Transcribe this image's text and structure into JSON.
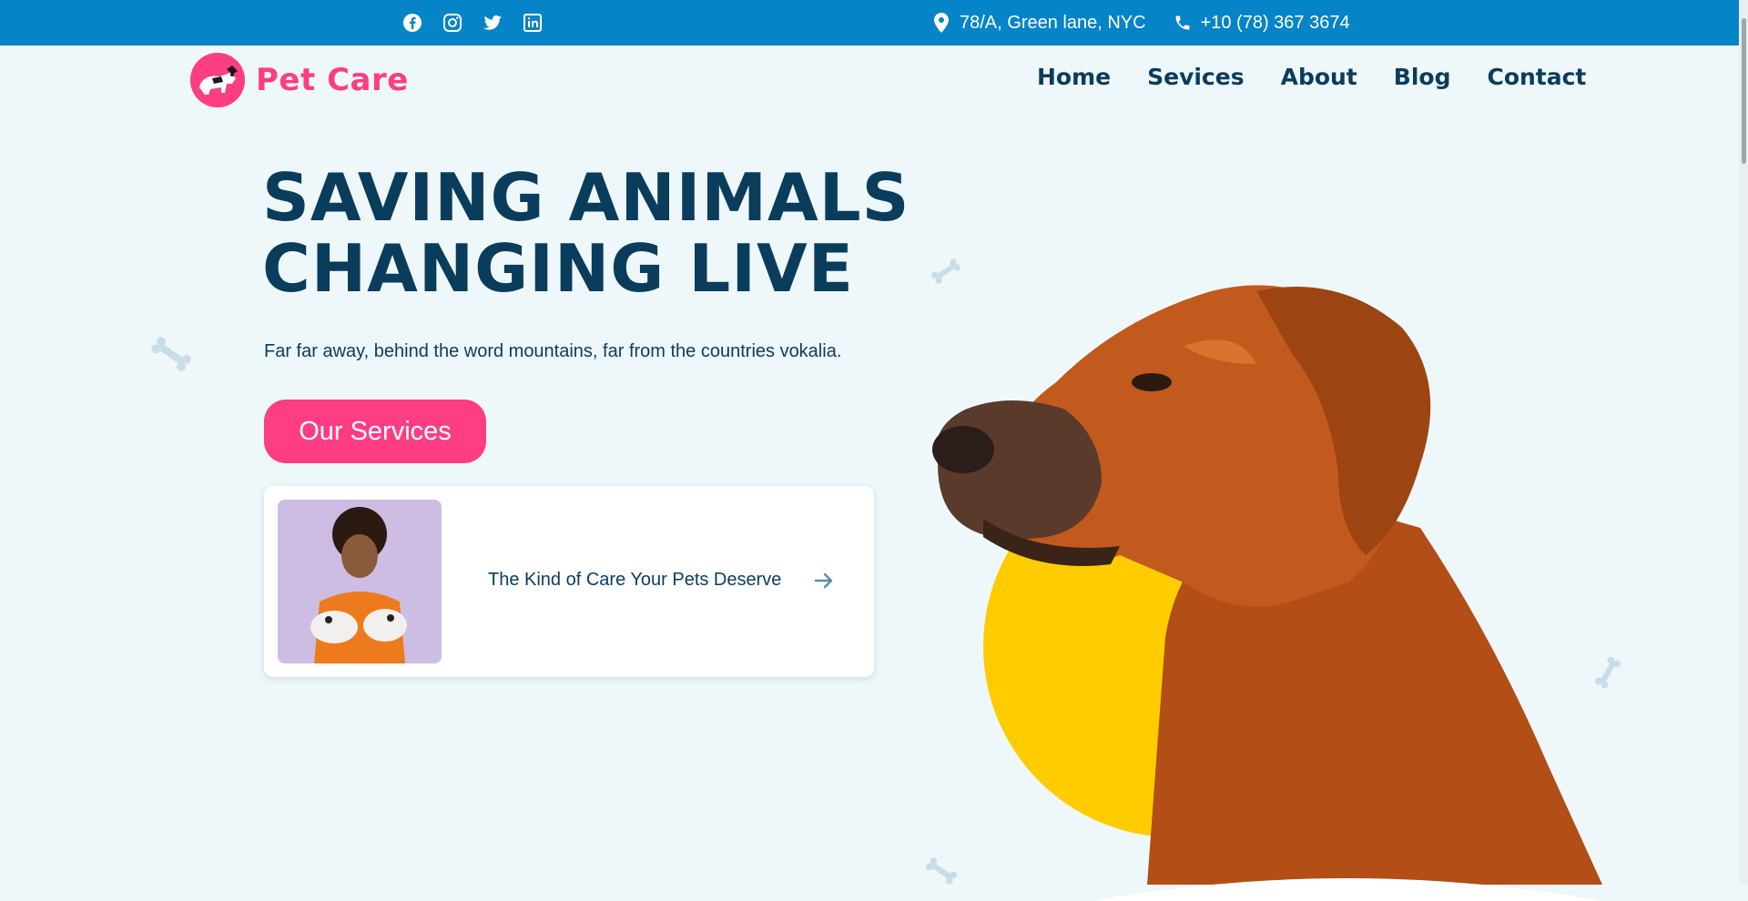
{
  "topbar": {
    "social_icons": [
      "facebook-icon",
      "instagram-icon",
      "twitter-icon",
      "linkedin-icon"
    ],
    "address": "78/A, Green lane, NYC",
    "phone": "+10 (78) 367 3674"
  },
  "header": {
    "logo_text": "Pet Care",
    "nav": [
      "Home",
      "Sevices",
      "About",
      "Blog",
      "Contact"
    ]
  },
  "hero": {
    "title_line1": "SAVING ANIMALS",
    "title_line2": "CHANGING LIVE",
    "subtitle": "Far far away, behind the word mountains, far from the countries vokalia.",
    "cta_label": "Our Services",
    "card_text": "The Kind of Care Your Pets Deserve"
  },
  "colors": {
    "topbar": "#0584c7",
    "brand_pink": "#ff3d83",
    "navy": "#0a3c5c",
    "background": "#eef8fb",
    "accent_yellow": "#ffcc00"
  }
}
